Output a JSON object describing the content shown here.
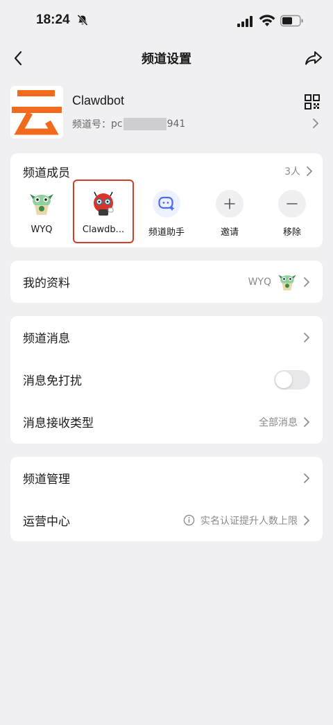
{
  "status_bar": {
    "time": "18:24"
  },
  "nav": {
    "title": "频道设置"
  },
  "channel": {
    "name": "Clawdbot",
    "id_label": "频道号：",
    "id_prefix": "pc",
    "id_suffix": "941"
  },
  "members": {
    "title": "频道成员",
    "count": "3人",
    "items": [
      {
        "name": "WYQ",
        "icon": "frog-avatar"
      },
      {
        "name": "Clawdb...",
        "icon": "red-bot-avatar"
      },
      {
        "name": "频道助手",
        "icon": "assistant-icon"
      },
      {
        "name": "邀请",
        "icon": "plus-icon"
      },
      {
        "name": "移除",
        "icon": "minus-icon"
      }
    ]
  },
  "profile": {
    "label": "我的资料",
    "value": "WYQ"
  },
  "messages": {
    "channel_messages": "频道消息",
    "mute": "消息免打扰",
    "mute_on": false,
    "receive_type": "消息接收类型",
    "receive_value": "全部消息"
  },
  "manage": {
    "channel_manage": "频道管理",
    "ops_center": "运营中心",
    "ops_hint": "实名认证提升人数上限"
  },
  "colors": {
    "accent": "#f26b1d",
    "highlight": "#d13d2b",
    "assistant": "#4a6cf7"
  }
}
